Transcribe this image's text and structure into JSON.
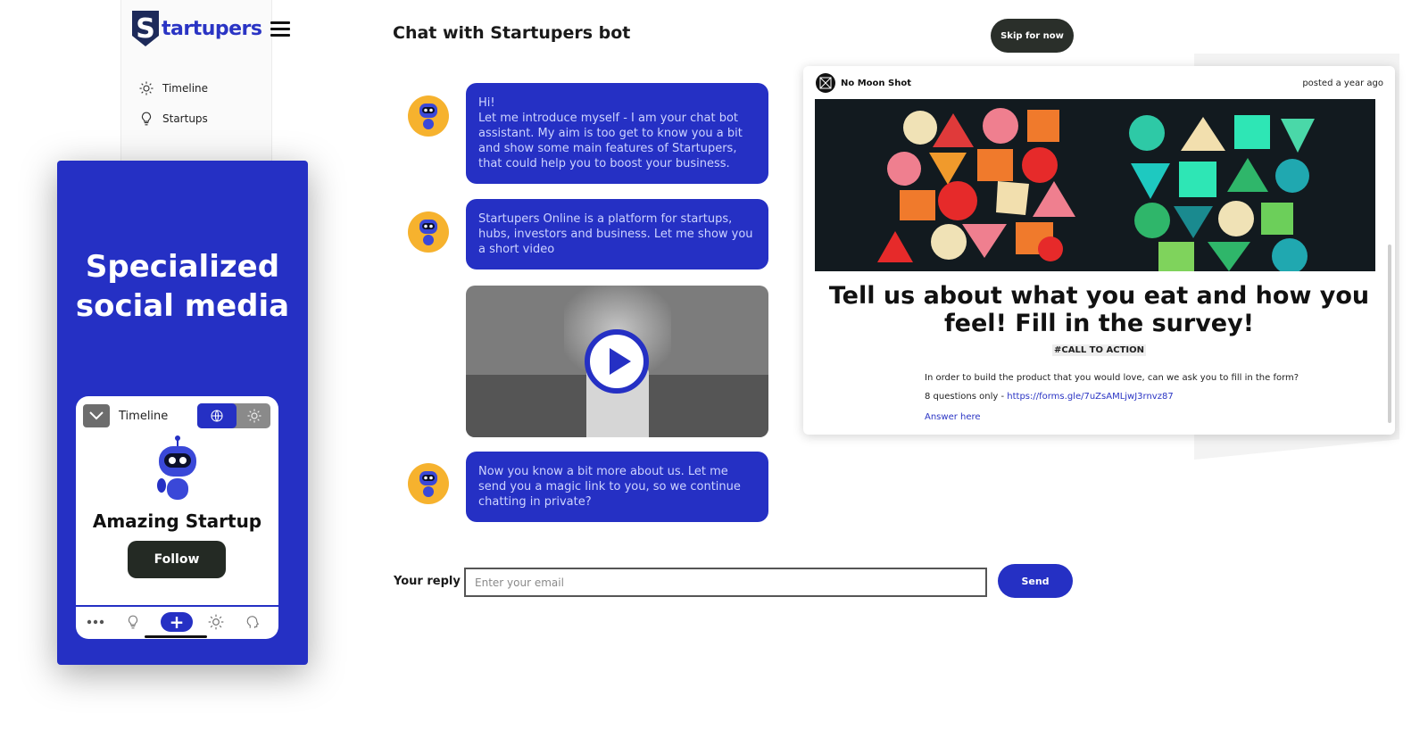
{
  "brand": {
    "logo_letter": "S",
    "logo_text": "tartupers"
  },
  "sidebar": {
    "items": [
      {
        "label": "Timeline",
        "icon": "gear-icon"
      },
      {
        "label": "Startups",
        "icon": "lightbulb-icon"
      }
    ]
  },
  "promo": {
    "title": "Specialized social media",
    "phone": {
      "header": "Timeline",
      "startup_name": "Amazing Startup",
      "follow_label": "Follow",
      "nav_add": "+"
    }
  },
  "chat": {
    "title": "Chat with Startupers bot",
    "skip_label": "Skip for now",
    "messages": [
      {
        "text": "Hi!\nLet me introduce myself - I am your chat bot assistant. My aim is too get to know you a bit and show some main features of Startupers, that could help you to boost your business."
      },
      {
        "text": "Startupers Online is a platform for startups, hubs, investors and business. Let me show you a short video"
      },
      {
        "text": "Now you know a bit more about us. Let me send you a magic link to you, so we continue chatting in private?"
      }
    ],
    "reply_label": "Your reply",
    "reply_placeholder": "Enter your email",
    "send_label": "Send"
  },
  "post": {
    "author": "No Moon Shot",
    "time": "posted a year ago",
    "title": "Tell us about what you eat and how you feel! Fill in the survey!",
    "tag": "#CALL TO ACTION",
    "body": "In order to build the product that you would love, can we ask you to fill in the form?",
    "questions_prefix": "8 questions only - ",
    "link": "https://forms.gle/7uZsAMLjwJ3rnvz87",
    "answer_label": "Answer here"
  },
  "colors": {
    "brand_blue": "#2530c4",
    "dark_button": "#2a2f2a",
    "avatar_yellow": "#f6b22e"
  }
}
